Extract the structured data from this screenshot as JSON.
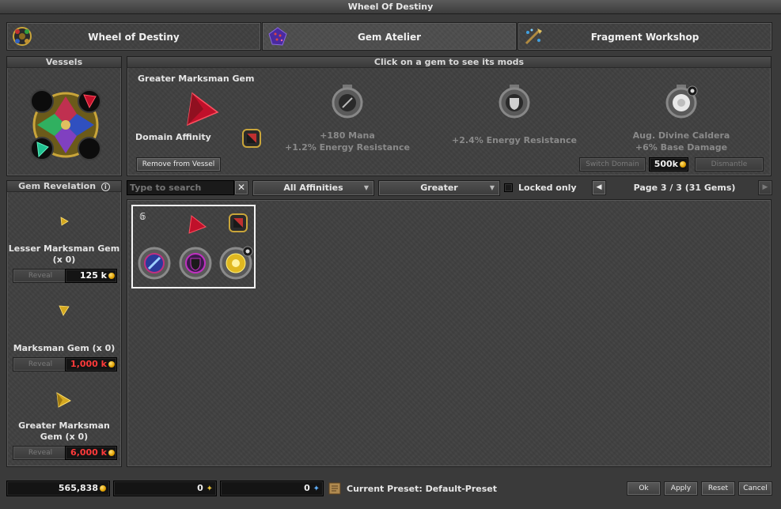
{
  "window": {
    "title": "Wheel Of Destiny"
  },
  "tabs": [
    {
      "label": "Wheel of Destiny",
      "icon": "wheel-icon"
    },
    {
      "label": "Gem Atelier",
      "icon": "gem-atelier-icon"
    },
    {
      "label": "Fragment Workshop",
      "icon": "fragment-workshop-icon"
    }
  ],
  "vessels": {
    "title": "Vessels"
  },
  "details": {
    "header": "Click on a gem to see its mods",
    "gem_name": "Greater Marksman Gem",
    "affinity_label": "Domain Affinity",
    "remove_button": "Remove from Vessel",
    "mods": [
      {
        "line1": "+180 Mana",
        "line2": "+1.2% Energy Resistance",
        "icon": "mana-mod-icon"
      },
      {
        "line1": "+2.4% Energy Resistance",
        "line2": "",
        "icon": "energy-resistance-mod-icon"
      },
      {
        "line1": "Aug. Divine Caldera",
        "line2": "+6% Base Damage",
        "icon": "divine-caldera-mod-icon"
      }
    ],
    "switch_domain": "Switch Domain",
    "switch_cost": "500k",
    "dismantle": "Dismantle"
  },
  "revelation": {
    "title": "Gem Revelation",
    "info_glyph": "i",
    "reveal_label": "Reveal",
    "items": [
      {
        "name": "Lesser Marksman Gem (x 0)",
        "cost": "125 k",
        "cost_color": "#ffffff"
      },
      {
        "name": "Marksman Gem (x 0)",
        "cost": "1,000 k",
        "cost_color": "#ff3a3a"
      },
      {
        "name": "Greater Marksman Gem (x 0)",
        "cost": "6,000 k",
        "cost_color": "#ff3a3a"
      }
    ]
  },
  "filters": {
    "search_placeholder": "Type to search",
    "clear_glyph": "✕",
    "affinity": "All Affinities",
    "grade": "Greater",
    "locked_only": "Locked only",
    "locked_checked": false,
    "page_text": "Page 3 / 3 (31 Gems)"
  },
  "grid": {
    "selected_gem": {
      "lock_glyph": "𝟞",
      "icon": "greater-marksman-gem-icon"
    }
  },
  "footer": {
    "gold": "565,838",
    "lesser_fragments": "0",
    "greater_fragments": "0",
    "preset": "Current Preset: Default-Preset",
    "ok": "Ok",
    "apply": "Apply",
    "reset": "Reset",
    "cancel": "Cancel"
  },
  "colors": {
    "accent_red": "#ff3a3a",
    "gem_red": "#c0102a",
    "gold_coin": "#e0a000",
    "selection_border": "#ffffff"
  }
}
